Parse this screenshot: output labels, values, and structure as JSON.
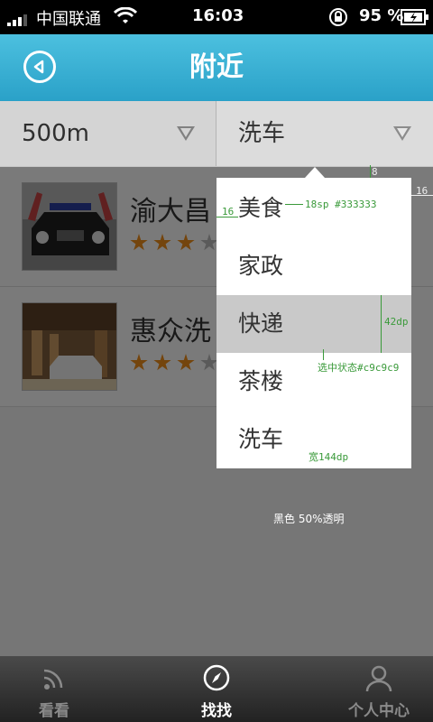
{
  "status_bar": {
    "carrier": "中国联通",
    "time": "16:03",
    "battery": "95 %"
  },
  "header": {
    "title": "附近",
    "back_icon": "back-circle-icon"
  },
  "filters": [
    {
      "label": "500m",
      "icon": "triangle-down-icon"
    },
    {
      "label": "洗车",
      "icon": "triangle-down-icon"
    }
  ],
  "list": {
    "items": [
      {
        "name": "渝大昌",
        "rating": 3,
        "max_rating": 5
      },
      {
        "name": "惠众洗",
        "rating": 3,
        "max_rating": 5
      }
    ]
  },
  "dropdown": {
    "options": [
      "美食",
      "家政",
      "快递",
      "茶楼",
      "洗车"
    ],
    "selected_index": 2
  },
  "annotations": {
    "offset_top": "8",
    "offset_right": "16",
    "offset_left": "16",
    "text_spec": "18sp #333333",
    "row_height": "42dp",
    "selected_state": "选中状态#c9c9c9",
    "width": "宽144dp",
    "overlay": "黑色 50%透明"
  },
  "tabbar": {
    "tabs": [
      {
        "label": "看看",
        "icon": "feed-icon",
        "active": false
      },
      {
        "label": "找找",
        "icon": "compass-icon",
        "active": true
      },
      {
        "label": "个人中心",
        "icon": "person-icon",
        "active": false
      }
    ]
  },
  "colors": {
    "header": "#2aa1c8",
    "selected_row": "#c9c9c9",
    "text": "#333333",
    "star_on": "#e88a1a",
    "star_off": "#b5b5b5",
    "annotation": "#3a9a3a"
  }
}
